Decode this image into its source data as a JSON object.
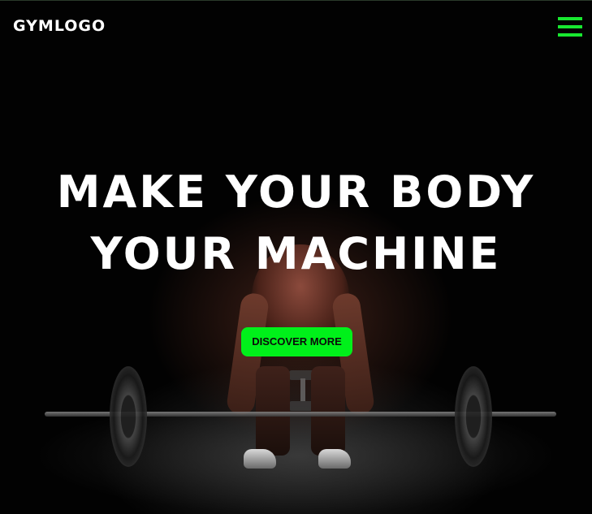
{
  "header": {
    "logo_text": "GYMLOGO",
    "menu_icon": "hamburger-menu-icon"
  },
  "hero": {
    "title_line_1": "MAKE YOUR BODY",
    "title_line_2": "YOUR MACHINE",
    "cta_label": "DISCOVER MORE",
    "background_image": "gym-weightlifter-photo"
  },
  "colors": {
    "accent": "#00f01a",
    "background": "#020202",
    "text": "#ffffff"
  }
}
